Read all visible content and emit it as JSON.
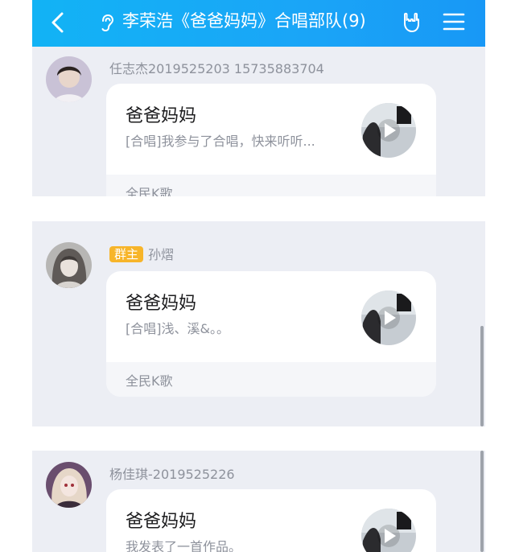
{
  "header": {
    "title": "李荣浩《爸爸妈妈》合唱部队(9)",
    "back_icon": "chevron-left-icon",
    "ear_icon": "ear-icon",
    "hand_icon": "rock-hand-icon",
    "menu_icon": "menu-icon",
    "bg_color": "#12b3f5"
  },
  "messages": [
    {
      "sender": "任志杰2019525203  15735883704",
      "badge": "",
      "card": {
        "title": "爸爸妈妈",
        "desc": "[合唱]我参与了合唱，快来听听...",
        "source": "全民K歌"
      }
    },
    {
      "sender": "孙熠",
      "badge": "群主",
      "card": {
        "title": "爸爸妈妈",
        "desc": "[合唱]浅、溪&。。",
        "source": "全民K歌"
      }
    },
    {
      "sender": "杨佳琪-2019525226",
      "badge": "",
      "card": {
        "title": "爸爸妈妈",
        "desc": "我发表了一首作品。",
        "source": ""
      }
    }
  ],
  "colors": {
    "badge": "#f7b52a",
    "chat_bg": "#eceef4"
  }
}
